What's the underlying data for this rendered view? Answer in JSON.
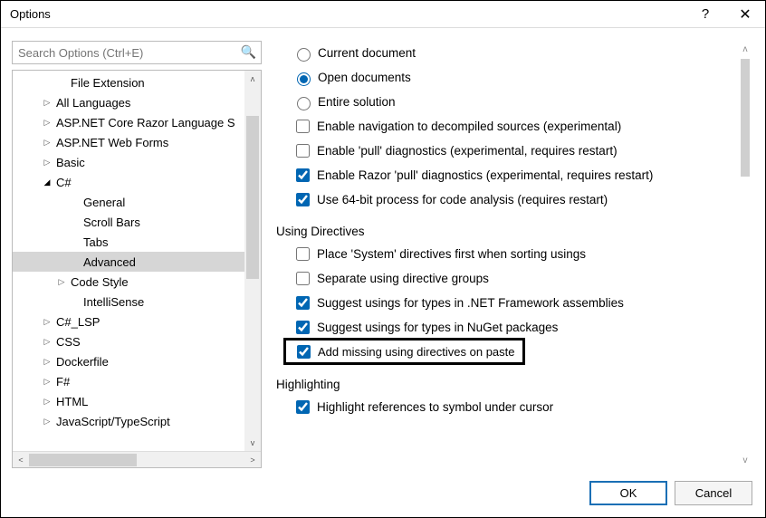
{
  "window": {
    "title": "Options"
  },
  "search": {
    "placeholder": "Search Options (Ctrl+E)"
  },
  "tree": {
    "items": [
      {
        "label": "File Extension",
        "indent": 48,
        "caret": ""
      },
      {
        "label": "All Languages",
        "indent": 32,
        "caret": "▷"
      },
      {
        "label": "ASP.NET Core Razor Language S",
        "indent": 32,
        "caret": "▷"
      },
      {
        "label": "ASP.NET Web Forms",
        "indent": 32,
        "caret": "▷"
      },
      {
        "label": "Basic",
        "indent": 32,
        "caret": "▷"
      },
      {
        "label": "C#",
        "indent": 32,
        "caret": "◢"
      },
      {
        "label": "General",
        "indent": 62,
        "caret": ""
      },
      {
        "label": "Scroll Bars",
        "indent": 62,
        "caret": ""
      },
      {
        "label": "Tabs",
        "indent": 62,
        "caret": ""
      },
      {
        "label": "Advanced",
        "indent": 62,
        "caret": "",
        "selected": true
      },
      {
        "label": "Code Style",
        "indent": 48,
        "caret": "▷"
      },
      {
        "label": "IntelliSense",
        "indent": 62,
        "caret": ""
      },
      {
        "label": "C#_LSP",
        "indent": 32,
        "caret": "▷"
      },
      {
        "label": "CSS",
        "indent": 32,
        "caret": "▷"
      },
      {
        "label": "Dockerfile",
        "indent": 32,
        "caret": "▷"
      },
      {
        "label": "F#",
        "indent": 32,
        "caret": "▷"
      },
      {
        "label": "HTML",
        "indent": 32,
        "caret": "▷"
      },
      {
        "label": "JavaScript/TypeScript",
        "indent": 32,
        "caret": "▷"
      }
    ]
  },
  "radios": {
    "r0": "Current document",
    "r1": "Open documents",
    "r2": "Entire solution"
  },
  "checks": {
    "c0": "Enable navigation to decompiled sources (experimental)",
    "c1": "Enable 'pull' diagnostics (experimental, requires restart)",
    "c2": "Enable Razor 'pull' diagnostics (experimental, requires restart)",
    "c3": "Use 64-bit process for code analysis (requires restart)"
  },
  "section1": "Using Directives",
  "using": {
    "u0": "Place 'System' directives first when sorting usings",
    "u1": "Separate using directive groups",
    "u2": "Suggest usings for types in .NET Framework assemblies",
    "u3": "Suggest usings for types in NuGet packages",
    "u4": "Add missing using directives on paste"
  },
  "section2": "Highlighting",
  "highlighting": {
    "h0": "Highlight references to symbol under cursor"
  },
  "buttons": {
    "ok": "OK",
    "cancel": "Cancel"
  }
}
